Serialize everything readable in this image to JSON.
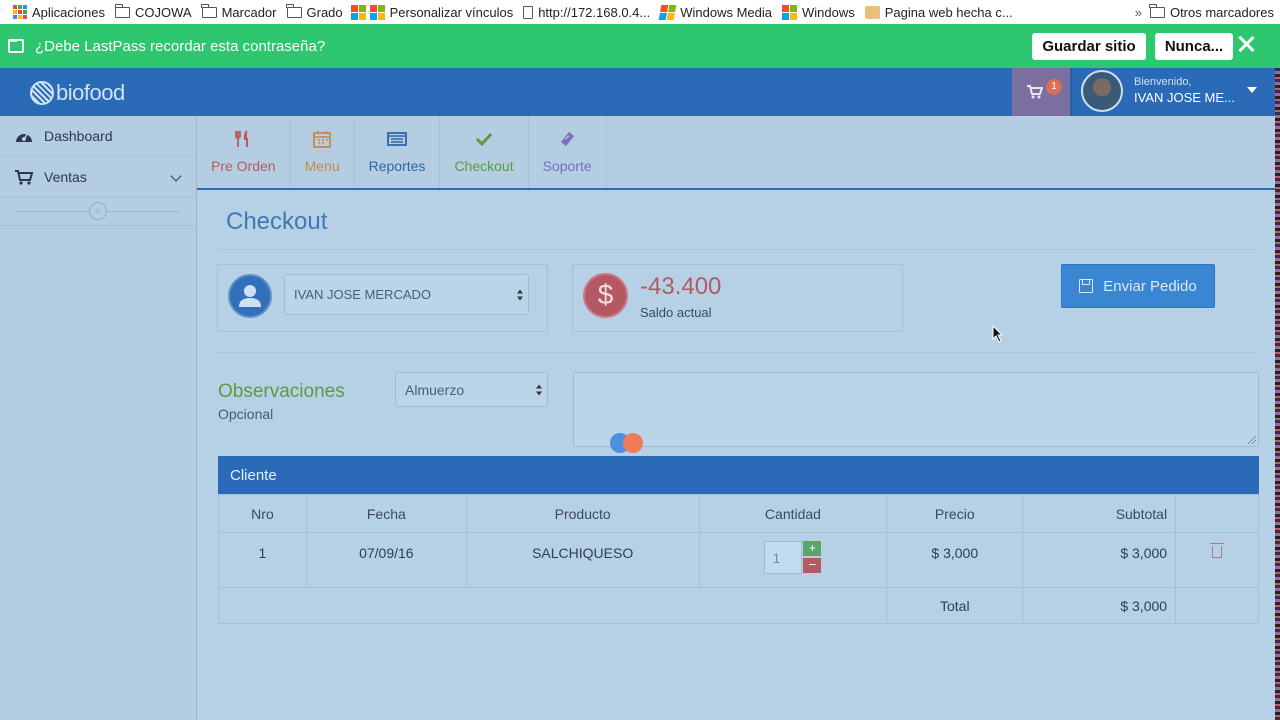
{
  "bookmarks": {
    "items": [
      "Aplicaciones",
      "COJOWA",
      "Marcador",
      "Grado",
      "Personalizar vínculos",
      "http://172.168.0.4...",
      "Windows Media",
      "Windows",
      "Pagina web hecha c..."
    ],
    "overflow": "»",
    "other": "Otros marcadores"
  },
  "lastpass": {
    "message": "¿Debe LastPass recordar esta contraseña?",
    "save_label": "Guardar sitio",
    "never_label": "Nunca...",
    "color": "#2ec66e"
  },
  "header": {
    "logo": "biofood",
    "cart_count": "1",
    "welcome": "Bienvenido,",
    "user_name": "IVAN JOSE ME...",
    "color": "#2a6ab6"
  },
  "sidebar": {
    "items": [
      {
        "label": "Dashboard",
        "icon": "dashboard-icon"
      },
      {
        "label": "Ventas",
        "icon": "cart-icon"
      }
    ],
    "toggle": "«"
  },
  "tabs": [
    {
      "label": "Pre Orden",
      "icon": "utensils-icon",
      "color": "#b85a5a"
    },
    {
      "label": "Menu",
      "icon": "calendar-icon",
      "color": "#c58a4a"
    },
    {
      "label": "Reportes",
      "icon": "list-icon",
      "color": "#2e66a8"
    },
    {
      "label": "Checkout",
      "icon": "check-icon",
      "color": "#5b9c3e"
    },
    {
      "label": "Soporte",
      "icon": "ticket-icon",
      "color": "#7a6ec0"
    }
  ],
  "checkout": {
    "title": "Checkout",
    "customer_select": "IVAN JOSE MERCADO",
    "balance": "-43.400",
    "balance_label": "Saldo actual",
    "send_button": "Enviar Pedido",
    "observations_title": "Observaciones",
    "observations_sub": "Opcional",
    "meal_select": "Almuerzo"
  },
  "table": {
    "panel_title": "Cliente",
    "headers": [
      "Nro",
      "Fecha",
      "Producto",
      "Cantidad",
      "Precio",
      "Subtotal"
    ],
    "rows": [
      {
        "nro": "1",
        "fecha": "07/09/16",
        "producto": "SALCHIQUESO",
        "cantidad": "1",
        "precio": "$ 3,000",
        "subtotal": "$ 3,000"
      }
    ],
    "qty_plus": "+",
    "qty_minus": "−",
    "total_label": "Total",
    "total_value": "$ 3,000"
  }
}
